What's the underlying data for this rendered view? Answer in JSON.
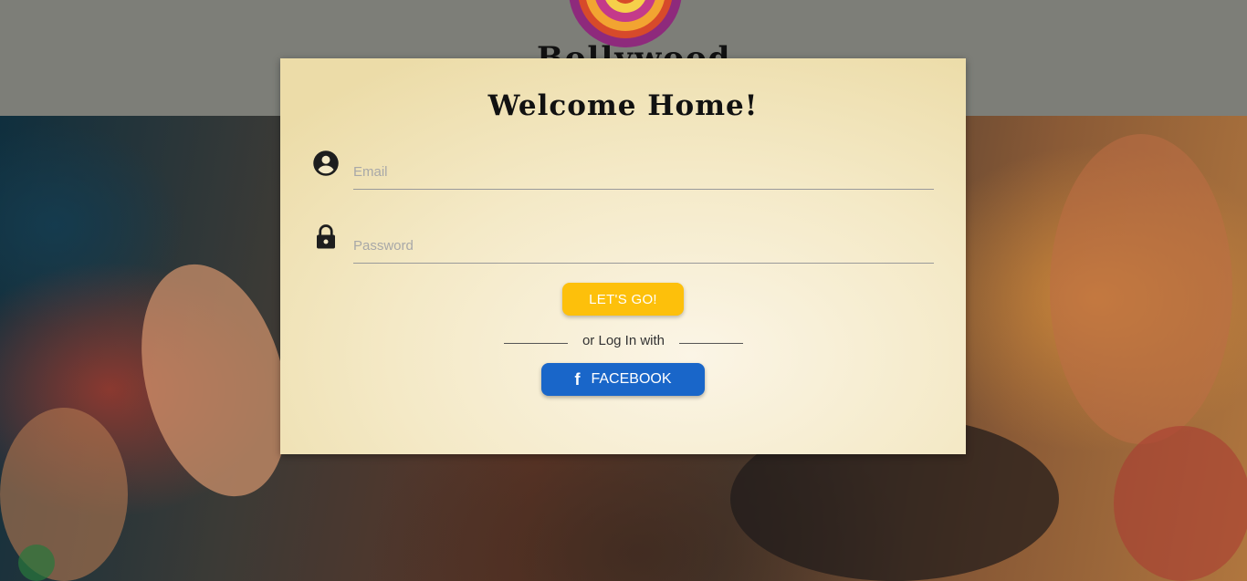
{
  "header": {
    "brand_text": "Bollywood"
  },
  "login": {
    "title": "Welcome Home!",
    "email": {
      "placeholder": "Email",
      "value": "",
      "icon": "account-circle-icon"
    },
    "password": {
      "placeholder": "Password",
      "value": "",
      "icon": "lock-icon"
    },
    "submit_label": "LET'S GO!",
    "divider_text": "or Log In with",
    "facebook": {
      "label": "FACEBOOK",
      "icon": "facebook-icon",
      "glyph": "f"
    }
  },
  "colors": {
    "submit": "#fdc00b",
    "facebook": "#1966c9",
    "card": "#f4e9c6"
  }
}
